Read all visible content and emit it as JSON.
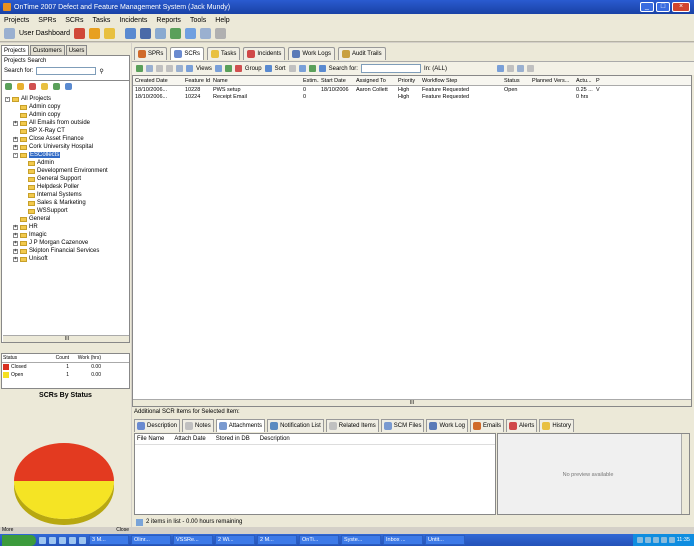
{
  "window": {
    "title": "OnTime 2007 Defect and Feature Management System (Jack Mundy)"
  },
  "menu": [
    "Projects",
    "SPRs",
    "SCRs",
    "Tasks",
    "Incidents",
    "Reports",
    "Tools",
    "Help"
  ],
  "toolbar1": {
    "user_dashboard": "User Dashboard"
  },
  "left": {
    "tabs": [
      "Projects",
      "Customers",
      "Users"
    ],
    "search_title": "Projects Search",
    "search_label": "Search for:",
    "tree": [
      {
        "label": "All Projects",
        "level": 0,
        "pm": "-"
      },
      {
        "label": "Admin copy",
        "level": 1,
        "pm": ""
      },
      {
        "label": "Admin copy",
        "level": 1,
        "pm": ""
      },
      {
        "label": "All Emails from outside",
        "level": 1,
        "pm": "+"
      },
      {
        "label": "BP X-Ray CT",
        "level": 1,
        "pm": ""
      },
      {
        "label": "Close Asset Finance",
        "level": 1,
        "pm": "+"
      },
      {
        "label": "Cork University Hospital",
        "level": 1,
        "pm": "+"
      },
      {
        "label": "ESCollects",
        "level": 1,
        "pm": "-",
        "selected": true
      },
      {
        "label": "Admin",
        "level": 2,
        "pm": ""
      },
      {
        "label": "Development Environment",
        "level": 2,
        "pm": ""
      },
      {
        "label": "General Support",
        "level": 2,
        "pm": ""
      },
      {
        "label": "Helpdesk Poller",
        "level": 2,
        "pm": ""
      },
      {
        "label": "Internal Systems",
        "level": 2,
        "pm": ""
      },
      {
        "label": "Sales & Marketing",
        "level": 2,
        "pm": ""
      },
      {
        "label": "WSSupport",
        "level": 2,
        "pm": ""
      },
      {
        "label": "General",
        "level": 1,
        "pm": ""
      },
      {
        "label": "HR",
        "level": 1,
        "pm": "+"
      },
      {
        "label": "Imagic",
        "level": 1,
        "pm": "+"
      },
      {
        "label": "J P Morgan Cazenove",
        "level": 1,
        "pm": "+"
      },
      {
        "label": "Skipton Financial Services",
        "level": 1,
        "pm": "+"
      },
      {
        "label": "Unisoft",
        "level": 1,
        "pm": "+"
      }
    ],
    "hscroll_label": "III",
    "status_table": {
      "headers": [
        "Status",
        "Count",
        "Work (hrs)"
      ],
      "rows": [
        {
          "status": "Closed",
          "count": "1",
          "work": "0.00",
          "color": "#d93020"
        },
        {
          "status": "Open",
          "count": "1",
          "work": "0.00",
          "color": "#f5e020"
        }
      ]
    },
    "chart_title": "SCRs By Status",
    "more": "More",
    "close": "Close"
  },
  "chart_data": {
    "type": "pie",
    "categories": [
      "Closed",
      "Open"
    ],
    "values": [
      1,
      1
    ],
    "colors": [
      "#e33a20",
      "#f5e424"
    ],
    "title": "SCRs By Status"
  },
  "right": {
    "tabs": [
      {
        "label": "SPRs",
        "color": "#d06a2a"
      },
      {
        "label": "SCRs",
        "color": "#6a8ad0",
        "active": true
      },
      {
        "label": "Tasks",
        "color": "#e8c040"
      },
      {
        "label": "Incidents",
        "color": "#d04848"
      },
      {
        "label": "Work Logs",
        "color": "#5a7ab8"
      },
      {
        "label": "Audit Trails",
        "color": "#c8a040"
      }
    ],
    "toolbar": {
      "views": "Views",
      "group": "Group",
      "sort": "Sort",
      "search_for": "Search for:",
      "filter": "In: (ALL)"
    },
    "grid": {
      "headers": [
        "Created Date",
        "Feature Id",
        "Name",
        "Estim...",
        "Start Date",
        "Assigned To",
        "Priority",
        "Workflow Step",
        "Status",
        "Planned Vers...",
        "Actu...",
        "P"
      ],
      "rows": [
        [
          "18/10/2006...",
          "10228",
          "PWS setup",
          "0",
          "18/10/2006",
          "Aaron Collett",
          "High",
          "Feature Requested",
          "Open",
          "",
          "0.25 ...",
          "V"
        ],
        [
          "18/10/2006...",
          "10224",
          "Receipt Email",
          "0",
          "",
          "",
          "High",
          "Feature Requested",
          "",
          "",
          "0 hrs",
          ""
        ]
      ]
    },
    "gscroll_label": "III",
    "additional_label": "Additional SCR Items for Selected Item:",
    "bottom_tabs": [
      {
        "label": "Description",
        "color": "#6a8ad0"
      },
      {
        "label": "Notes",
        "color": "#c0c0c0"
      },
      {
        "label": "Attachments",
        "color": "#7a9ad0",
        "active": true
      },
      {
        "label": "Notification List",
        "color": "#5a8ac0"
      },
      {
        "label": "Related Items",
        "color": "#c0c0c0"
      },
      {
        "label": "SCM Files",
        "color": "#7a9ad0"
      },
      {
        "label": "Work Log",
        "color": "#5a7ab8"
      },
      {
        "label": "Emails",
        "color": "#d06a2a"
      },
      {
        "label": "Alerts",
        "color": "#d04848"
      },
      {
        "label": "History",
        "color": "#e8c040"
      }
    ],
    "attach_headers": [
      "File Name",
      "Attach Date",
      "Stored in DB",
      "Description"
    ],
    "preview_msg": "No preview available",
    "status_text": "2 items in list - 0.00 hours remaining"
  },
  "taskbar": {
    "tasks": [
      "3 M...",
      "Olinr...",
      "VSSRe...",
      "2 Wi...",
      "2 M...",
      "OnTi...",
      "Syste...",
      "Inbox ...",
      "Untit..."
    ],
    "clock": "11:35"
  }
}
